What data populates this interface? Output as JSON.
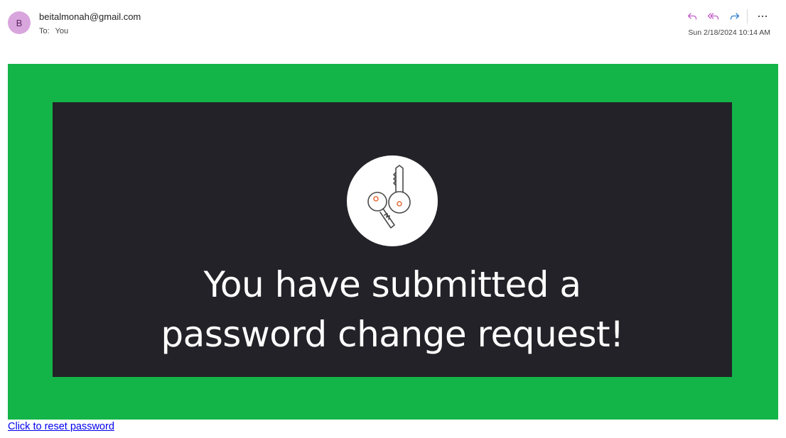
{
  "email": {
    "avatar_initial": "B",
    "sender": "beitalmonah@gmail.com",
    "to_label": "To:",
    "to_value": "You",
    "timestamp": "Sun 2/18/2024 10:14 AM"
  },
  "actions": {
    "icons": [
      "reply-icon",
      "reply-all-icon",
      "forward-icon",
      "more-icon"
    ]
  },
  "banner": {
    "headline_line1": "You have submitted a",
    "headline_line2": "password change request!",
    "icon": "keys-icon",
    "outer_color": "#13b548",
    "inner_color": "#232228"
  },
  "link": {
    "label": "Click to reset password"
  },
  "colors": {
    "avatar_bg": "#d9a5dd",
    "reply_accent": "#c25dc9",
    "forward_accent": "#2f80d0",
    "key_dot": "#e86a3a"
  }
}
